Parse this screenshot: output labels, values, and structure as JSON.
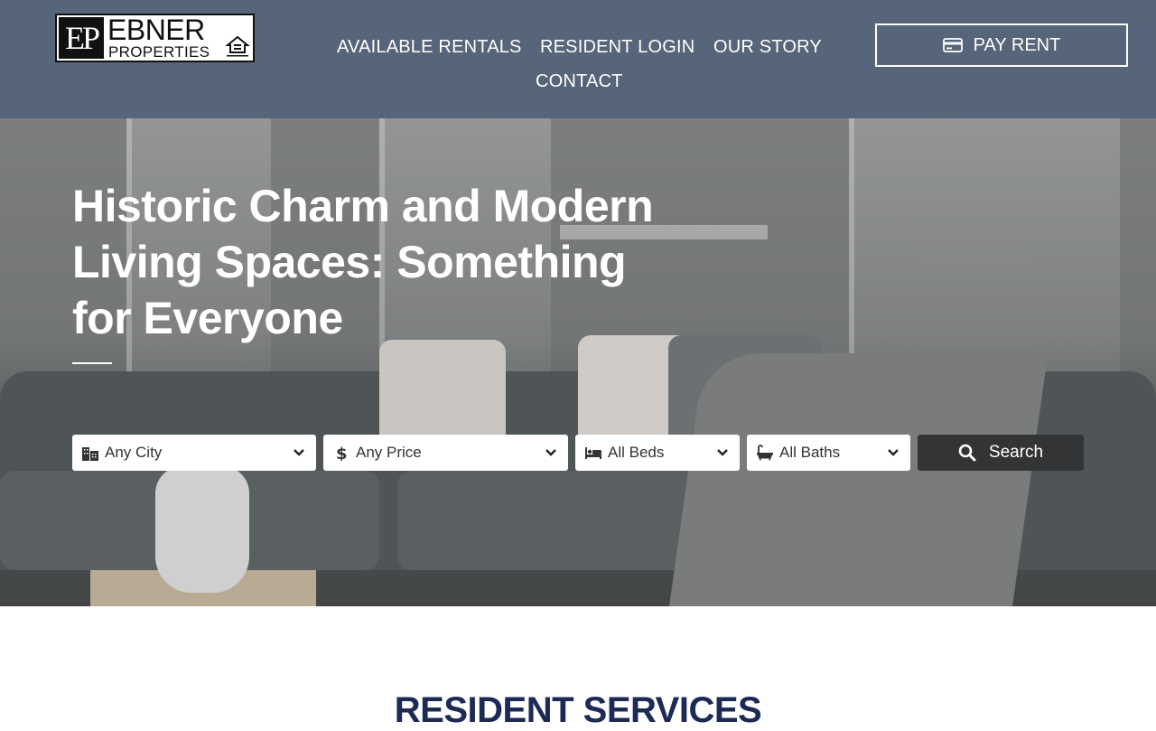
{
  "brand": {
    "monogram": "EP",
    "name_line1": "EBNER",
    "name_line2": "PROPERTIES",
    "badge_text": "EQUAL HOUSING OPPORTUNITY"
  },
  "nav": {
    "items": [
      "AVAILABLE RENTALS",
      "RESIDENT LOGIN",
      "OUR STORY",
      "CONTACT"
    ]
  },
  "pay_button": {
    "label": "PAY RENT",
    "icon": "credit-card-icon"
  },
  "hero": {
    "title": "Historic Charm and Modern Living Spaces: Something for Everyone"
  },
  "filters": {
    "city": {
      "value": "Any City",
      "icon": "building-icon"
    },
    "price": {
      "value": "Any Price",
      "icon": "dollar-icon"
    },
    "beds": {
      "value": "All Beds",
      "icon": "bed-icon"
    },
    "baths": {
      "value": "All Baths",
      "icon": "bath-icon"
    },
    "search_label": "Search"
  },
  "sections": {
    "resident_services_title": "RESIDENT SERVICES"
  },
  "colors": {
    "header_bg": "#566579",
    "search_button_bg": "#333436",
    "section_title": "#1c2a55"
  }
}
